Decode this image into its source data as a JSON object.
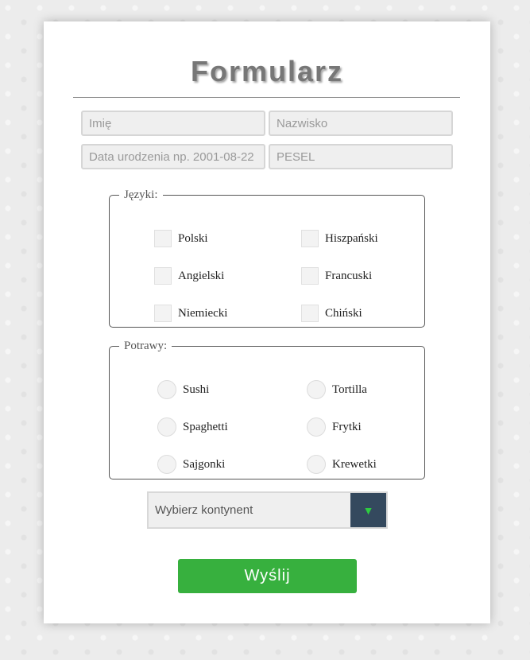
{
  "form": {
    "title": "Formularz",
    "fields": {
      "first_name": {
        "placeholder": "Imię"
      },
      "last_name": {
        "placeholder": "Nazwisko"
      },
      "birth_date": {
        "placeholder": "Data urodzenia np. 2001-08-22"
      },
      "pesel": {
        "placeholder": "PESEL"
      }
    },
    "languages": {
      "legend": "Języki:",
      "items": [
        "Polski",
        "Hiszpański",
        "Angielski",
        "Francuski",
        "Niemiecki",
        "Chiński"
      ]
    },
    "dishes": {
      "legend": "Potrawy:",
      "items": [
        "Sushi",
        "Tortilla",
        "Spaghetti",
        "Frytki",
        "Sajgonki",
        "Krewetki"
      ]
    },
    "continent_select": {
      "value": "Wybierz kontynent",
      "icon": "triangle-down-icon"
    },
    "submit_label": "Wyślij"
  },
  "colors": {
    "submit_button": "#37b03e",
    "select_arrow_bg": "#34495e",
    "select_arrow": "#2ecc40"
  }
}
